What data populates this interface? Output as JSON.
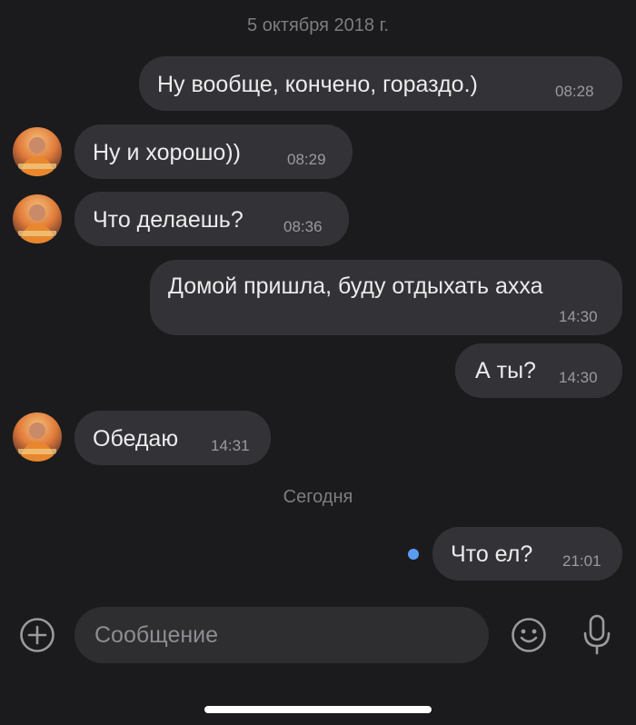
{
  "date_separators": {
    "first": "5 октября 2018 г.",
    "today": "Сегодня"
  },
  "messages": [
    {
      "direction": "out",
      "text": "Ну вообще, кончено, гораздо.)",
      "time": "08:28"
    },
    {
      "direction": "in",
      "text": "Ну и хорошо))",
      "time": "08:29"
    },
    {
      "direction": "in",
      "text": "Что делаешь?",
      "time": "08:36"
    },
    {
      "direction": "out",
      "text": "Домой пришла, буду отдыхать ахха",
      "time": "14:30"
    },
    {
      "direction": "out",
      "text": "А ты?",
      "time": "14:30"
    },
    {
      "direction": "in",
      "text": "Обедаю",
      "time": "14:31"
    },
    {
      "direction": "out",
      "text": "Что ел?",
      "time": "21:01"
    }
  ],
  "composer": {
    "placeholder": "Сообщение"
  },
  "colors": {
    "background": "#1b1b1d",
    "bubble": "#333337",
    "unread_dot": "#5a9cf2"
  },
  "icons": {
    "add": "plus-circle-icon",
    "emoji": "smiley-icon",
    "voice": "microphone-icon"
  }
}
